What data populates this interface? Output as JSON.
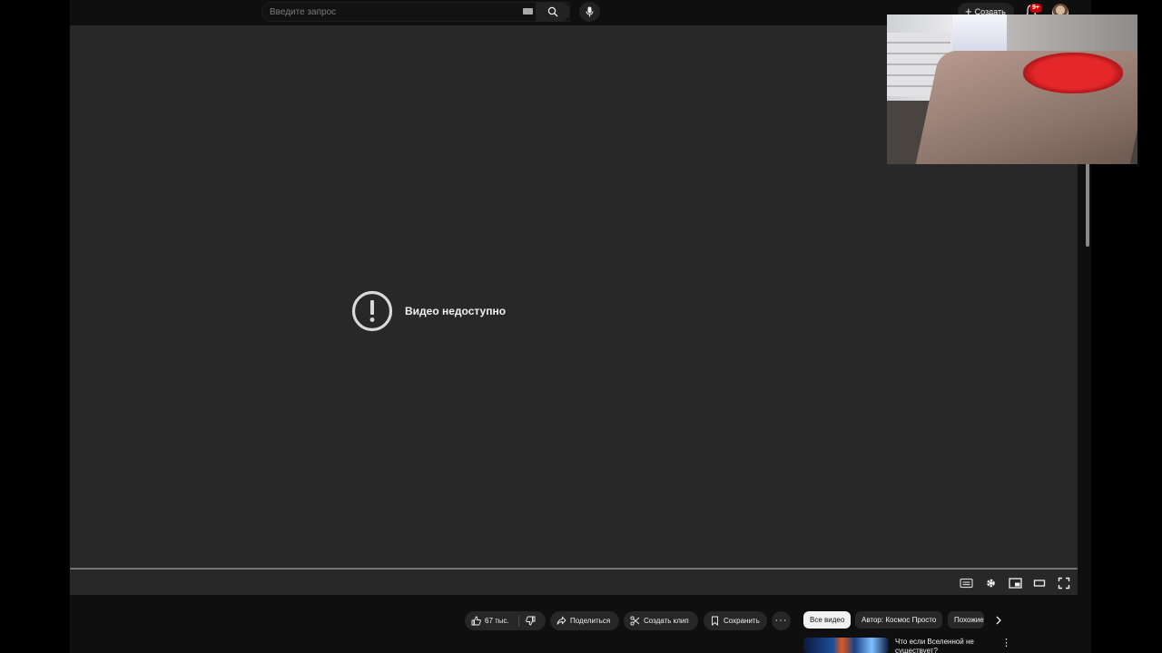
{
  "search": {
    "placeholder": "Введите запрос"
  },
  "header": {
    "create_label": "Создать",
    "notification_badge": "9+"
  },
  "player": {
    "error_message": "Видео недоступно"
  },
  "actions": {
    "like_count": "67 тыс.",
    "share_label": "Поделиться",
    "clip_label": "Создать клип",
    "save_label": "Сохранить",
    "more_label": "···"
  },
  "chips": [
    "Все видео",
    "Автор: Космос Просто",
    "Похожие"
  ],
  "recommendations": [
    {
      "title": "Что если Вселенной не существует?",
      "menu": "⋮"
    }
  ],
  "icons": {
    "search": "search-icon",
    "mic": "mic-icon",
    "keyboard": "keyboard-icon",
    "bell": "bell-icon",
    "error": "error-exclamation-icon",
    "subtitles": "subtitles-icon",
    "settings": "gear-icon",
    "miniplayer": "miniplayer-icon",
    "theater": "theater-mode-icon",
    "fullscreen": "fullscreen-icon",
    "like": "thumbs-up-icon",
    "dislike": "thumbs-down-icon",
    "share": "share-icon",
    "clip": "scissors-icon",
    "save": "bookmark-icon",
    "chevron": "chevron-right-icon"
  },
  "colors": {
    "background": "#0f0f0f",
    "player_bg": "#282828",
    "pill_bg": "#272727",
    "badge": "#cc0000"
  }
}
